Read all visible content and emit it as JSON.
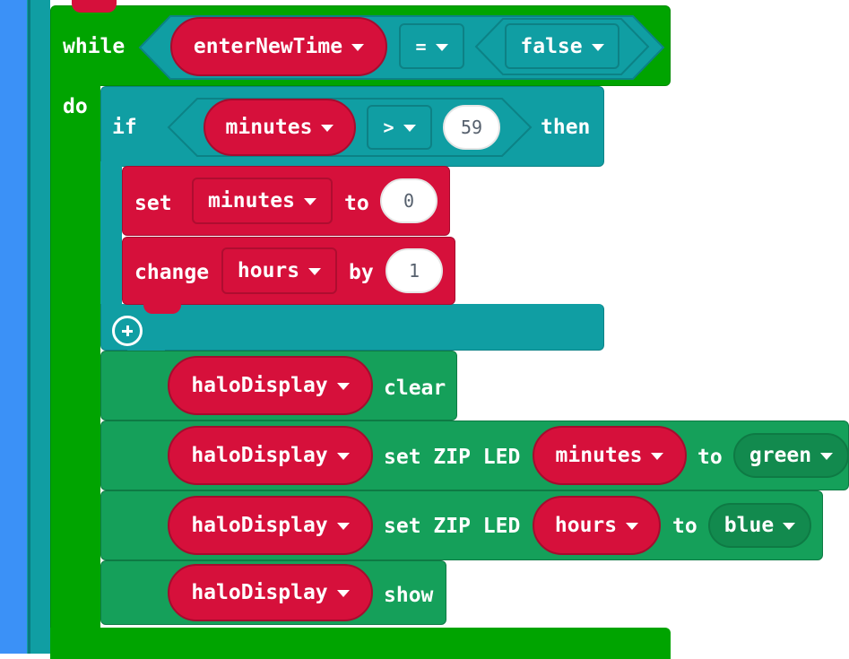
{
  "colors": {
    "loops_green": "#00a400",
    "logic_teal": "#109ea3",
    "variables_red": "#d6103b",
    "extension_green": "#15a05a",
    "left_bar_blue": "#3b91f7"
  },
  "while_block": {
    "keyword": "while",
    "condition_var": "enterNewTime",
    "operator": "=",
    "value": "false",
    "do_label": "do"
  },
  "if_block": {
    "keyword": "if",
    "var": "minutes",
    "operator": ">",
    "number": "59",
    "then_label": "then",
    "add_icon": "plus-circle-icon"
  },
  "set_block": {
    "keyword": "set",
    "var": "minutes",
    "to_label": "to",
    "value": "0"
  },
  "change_block": {
    "keyword": "change",
    "var": "hours",
    "by_label": "by",
    "value": "1"
  },
  "halo_blocks": {
    "clear": {
      "target": "haloDisplay",
      "action": "clear"
    },
    "led_minutes": {
      "target": "haloDisplay",
      "action": "set ZIP LED",
      "var": "minutes",
      "to_label": "to",
      "color": "green"
    },
    "led_hours": {
      "target": "haloDisplay",
      "action": "set ZIP LED",
      "var": "hours",
      "to_label": "to",
      "color": "blue"
    },
    "show": {
      "target": "haloDisplay",
      "action": "show"
    }
  }
}
